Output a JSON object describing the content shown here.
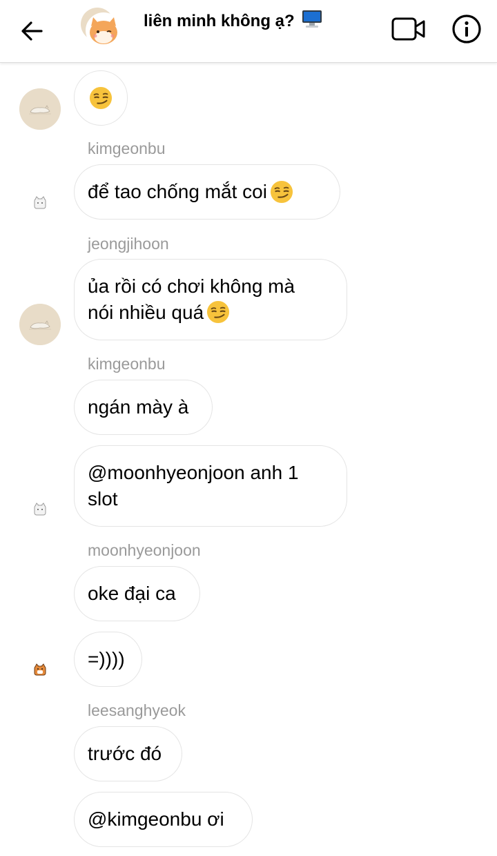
{
  "header": {
    "title": "liên minh không ạ?",
    "title_emoji": "🖥️"
  },
  "messages": [
    {
      "sender": "",
      "text": ""
    },
    {
      "sender": "kimgeonbu",
      "text": "để tao chống mắt coi"
    },
    {
      "sender": "jeongjihoon",
      "line1": "ủa rồi có chơi không mà",
      "line2": "nói nhiều quá"
    },
    {
      "sender": "kimgeonbu",
      "text": "ngán mày à"
    },
    {
      "sender": "",
      "line1": "@moonhyeonjoon anh 1",
      "line2": "slot"
    },
    {
      "sender": "moonhyeonjoon",
      "text": "oke đại ca"
    },
    {
      "sender": "",
      "text": "=))))"
    },
    {
      "sender": "leesanghyeok",
      "text": "trước đó"
    },
    {
      "sender": "",
      "text": "@kimgeonbu ơi"
    }
  ],
  "icons": {
    "back": "arrow-left-icon",
    "video": "video-camera-icon",
    "info": "info-circle-icon",
    "smirk": "smirking-face-emoji"
  },
  "colors": {
    "bubble_border": "#e4e4e4",
    "sender_text": "#9a9a9a",
    "avatar_beige": "#e8dcc8",
    "emoji_yellow": "#f7c33c"
  }
}
